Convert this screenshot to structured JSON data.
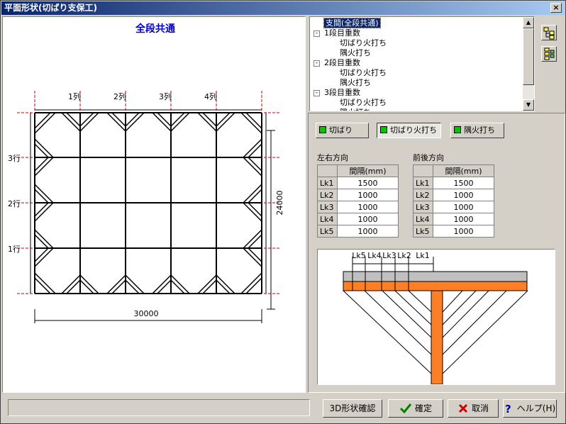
{
  "window": {
    "title": "平面形状(切ばり支保工)",
    "close_glyph": "×"
  },
  "plan": {
    "title": "全段共通",
    "columns": [
      "1列",
      "2列",
      "3列",
      "4列"
    ],
    "rows": [
      "3行",
      "2行",
      "1行"
    ],
    "width_dim": "30000",
    "height_dim": "24000"
  },
  "tree": {
    "items": [
      {
        "label": "支間(全段共通)",
        "level": 0,
        "selected": true
      },
      {
        "label": "1段目重数",
        "level": 0,
        "expander": "-"
      },
      {
        "label": "切ばり火打ち",
        "level": 1
      },
      {
        "label": "隅火打ち",
        "level": 1
      },
      {
        "label": "2段目重数",
        "level": 0,
        "expander": "-"
      },
      {
        "label": "切ばり火打ち",
        "level": 1
      },
      {
        "label": "隅火打ち",
        "level": 1
      },
      {
        "label": "3段目重数",
        "level": 0,
        "expander": "-"
      },
      {
        "label": "切ばり火打ち",
        "level": 1
      },
      {
        "label": "隅火打ち",
        "level": 1
      }
    ]
  },
  "toggles": {
    "kiribari": "切ばり",
    "kiribari_hiuchi": "切ばり火打ち",
    "sumi_hiuchi": "隅火打ち"
  },
  "left_right": {
    "label": "左右方向",
    "header": "間隔(mm)",
    "rows": [
      {
        "name": "Lk1",
        "value": "1500"
      },
      {
        "name": "Lk2",
        "value": "1000"
      },
      {
        "name": "Lk3",
        "value": "1000"
      },
      {
        "name": "Lk4",
        "value": "1000"
      },
      {
        "name": "Lk5",
        "value": "1000"
      }
    ]
  },
  "front_back": {
    "label": "前後方向",
    "header": "間隔(mm)",
    "rows": [
      {
        "name": "Lk1",
        "value": "1500"
      },
      {
        "name": "Lk2",
        "value": "1000"
      },
      {
        "name": "Lk3",
        "value": "1000"
      },
      {
        "name": "Lk4",
        "value": "1000"
      },
      {
        "name": "Lk5",
        "value": "1000"
      }
    ]
  },
  "detail_labels": [
    "Lk5",
    "Lk4",
    "Lk3",
    "Lk2",
    "Lk1"
  ],
  "buttons": {
    "view3d": "3D形状確認",
    "ok": "確定",
    "cancel": "取消",
    "help": "ヘルプ(H)"
  },
  "colors": {
    "accent_orange": "#ff7f27",
    "led_green": "#00c800",
    "title_blue": "#0000cc"
  }
}
